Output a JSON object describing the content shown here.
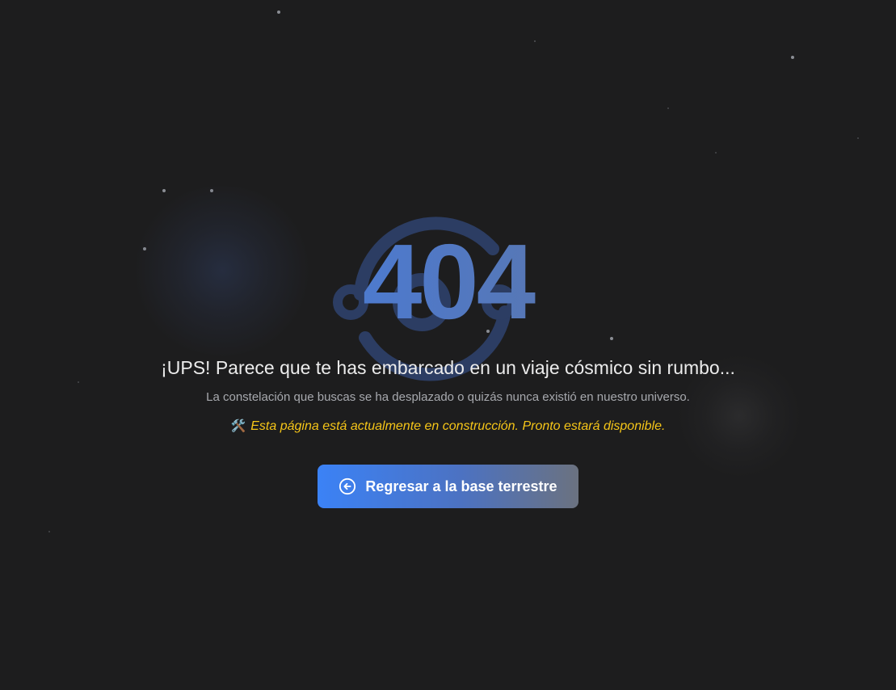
{
  "error": {
    "code": "404",
    "headline": "¡UPS! Parece que te has embarcado en un viaje cósmico sin rumbo...",
    "description": "La constelación que buscas se ha desplazado o quizás nunca existió en nuestro universo.",
    "construction_notice": "Esta página está actualmente en construcción. Pronto estará disponible.",
    "notice_icon": "🛠️"
  },
  "actions": {
    "home_button_label": "Regresar a la base terrestre",
    "home_button_icon": "arrow-left-circle-icon"
  },
  "colors": {
    "background": "#1d1d1e",
    "accent_start": "#3b82f6",
    "accent_end": "#6b7280",
    "notice": "#f5c518"
  }
}
